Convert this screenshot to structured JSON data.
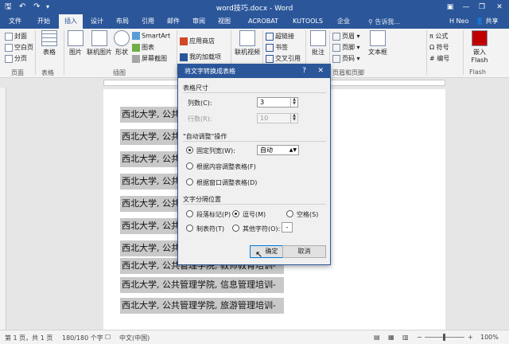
{
  "window": {
    "title": "word技巧.docx - Word",
    "min": "—",
    "restore": "❐",
    "close": "✕",
    "ribbon_opts": "▣"
  },
  "quick_access": {
    "save": "🖫",
    "undo": "↶",
    "redo": "↷",
    "more": "▾"
  },
  "menu": {
    "tabs": [
      "文件",
      "开始",
      "插入",
      "设计",
      "布局",
      "引用",
      "邮件",
      "审阅",
      "视图",
      "ACROBAT",
      "KUTOOLS",
      "企业"
    ],
    "active": "插入",
    "search": "告诉我...",
    "user": "H Neo",
    "share": "共享"
  },
  "ribbon": {
    "pages": {
      "cover": "封面",
      "blank": "空白页",
      "break": "分页",
      "label": "页面"
    },
    "table": {
      "label": "表格",
      "group": "表格"
    },
    "illustrations": {
      "picture": "图片",
      "online_picture": "联机图片",
      "shapes": "形状",
      "smartart": "SmartArt",
      "chart": "图表",
      "screenshot": "屏幕截图",
      "group": "插图"
    },
    "addins": {
      "store": "应用商店",
      "my_addins": "我的加载项"
    },
    "media": {
      "online_video": "联机视频"
    },
    "links": {
      "hyperlink": "超链接",
      "bookmark": "书签",
      "cross_ref": "交叉引用"
    },
    "comments": {
      "comment": "批注"
    },
    "header_footer": {
      "header": "页眉",
      "footer": "页脚",
      "page_number": "页码",
      "group": "页眉和页脚"
    },
    "text": {
      "textbox": "文本框"
    },
    "symbols": {
      "equation": "公式",
      "symbol": "符号",
      "numbering": "编号"
    },
    "flash": {
      "insert": "嵌入 Flash",
      "group": "Flash"
    }
  },
  "document": {
    "lines": [
      "西北大学, 公共",
      "西北大学, 公共",
      "西北大学, 公共",
      "西北大学, 公共",
      "西北大学, 公共",
      "西北大学, 公共",
      "西北大学, 公共",
      "西北大学, 公共管理学院, 教师教育培训-",
      "西北大学, 公共管理学院, 信息管理培训-",
      "西北大学, 公共管理学院, 旅游管理培训-"
    ]
  },
  "dialog": {
    "title": "将文字转换成表格",
    "help": "?",
    "close": "✕",
    "table_size": "表格尺寸",
    "columns_label": "列数(C):",
    "columns_value": "3",
    "rows_label": "行数(R):",
    "rows_value": "10",
    "autofit_title": "\"自动调整\"操作",
    "fixed_width": "固定列宽(W):",
    "fixed_width_value": "自动",
    "fit_content": "根据内容调整表格(F)",
    "fit_window": "根据窗口调整表格(D)",
    "separator_title": "文字分隔位置",
    "sep_paragraph": "段落标记(P)",
    "sep_comma": "逗号(M)",
    "sep_space": "空格(S)",
    "sep_tab": "制表符(T)",
    "sep_other": "其他字符(O):",
    "sep_other_value": "-",
    "ok": "确定",
    "cancel": "取消"
  },
  "status": {
    "page": "第 1 页，共 1 页",
    "words": "180/180 个字",
    "proof": "☐",
    "lang": "中文(中国)",
    "zoom_minus": "−",
    "zoom_plus": "+",
    "zoom": "100%"
  }
}
